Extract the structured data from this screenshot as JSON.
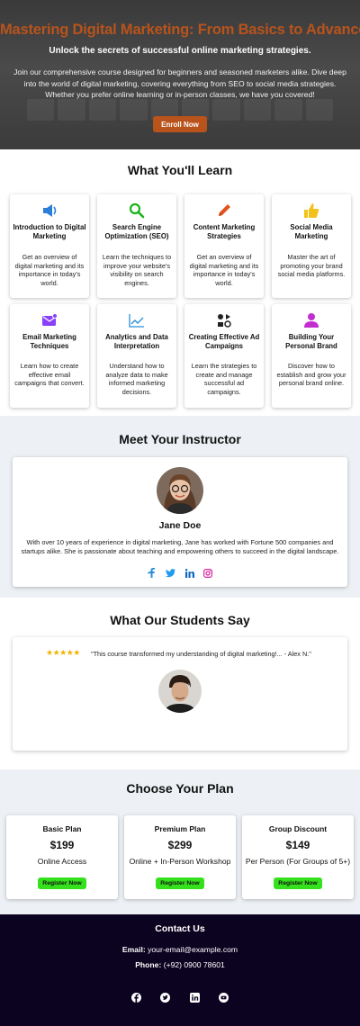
{
  "hero": {
    "title": "Mastering Digital Marketing: From Basics to Advanced",
    "subtitle": "Unlock the secrets of successful online marketing strategies.",
    "description": "Join our comprehensive course designed for beginners and seasoned marketers alike. Dive deep into the world of digital marketing, covering everything from SEO to social media strategies. Whether you prefer online learning or in-person classes, we have you covered!",
    "cta_label": "Enroll Now"
  },
  "learn": {
    "title": "What You'll Learn",
    "cards": [
      {
        "icon": "megaphone-icon",
        "title": "Introduction to Digital Marketing",
        "desc": "Get an overview of digital marketing and its importance in today's world."
      },
      {
        "icon": "search-icon",
        "title": "Search Engine Optimization (SEO)",
        "desc": "Learn the techniques to improve your website's visibility on search engines."
      },
      {
        "icon": "pencil-icon",
        "title": "Content Marketing Strategies",
        "desc": "Get an overview of digital marketing and its importance in today's world."
      },
      {
        "icon": "thumbs-up-icon",
        "title": "Social Media Marketing",
        "desc": "Master the art of promoting your brand social media platforms."
      },
      {
        "icon": "email-icon",
        "title": "Email Marketing Techniques",
        "desc": "Learn how to create effective email campaigns that convert."
      },
      {
        "icon": "chart-line-icon",
        "title": "Analytics and Data Interpretation",
        "desc": "Understand how to analyze data to make informed marketing decisions."
      },
      {
        "icon": "ads-icon",
        "title": "Creating Effective Ad Campaigns",
        "desc": "Learn the strategies to create and manage successful ad campaigns."
      },
      {
        "icon": "person-icon",
        "title": "Building Your Personal Brand",
        "desc": "Discover how to establish and grow your personal brand online."
      }
    ]
  },
  "instructor": {
    "title": "Meet Your Instructor",
    "name": "Jane Doe",
    "bio": "With over 10 years of experience in digital marketing, Jane has worked with Fortune 500 companies and startups alike. She is passionate about teaching and empowering others to succeed in the digital landscape.",
    "socials": [
      "facebook-icon",
      "twitter-icon",
      "linkedin-icon",
      "instagram-icon"
    ]
  },
  "testimonials": {
    "title": "What Our Students Say",
    "stars": "★★★★★",
    "quote": "\"This course transformed my understanding of digital marketing!... - Alex N.\""
  },
  "plans": {
    "title": "Choose Your Plan",
    "items": [
      {
        "name": "Basic Plan",
        "price": "$199",
        "desc": "Online Access",
        "button": "Register Now"
      },
      {
        "name": "Premium Plan",
        "price": "$299",
        "desc": "Online + In-Person Workshop",
        "button": "Register Now"
      },
      {
        "name": "Group Discount",
        "price": "$149",
        "desc": "Per Person (For Groups of 5+)",
        "button": "Register Now"
      }
    ]
  },
  "contact": {
    "title": "Contact Us",
    "email_label": "Email:",
    "email": "your-email@example.com",
    "phone_label": "Phone:",
    "phone": "(+92) 0900 78601",
    "socials": [
      "facebook-icon",
      "twitter-icon",
      "linkedin-icon",
      "youtube-icon"
    ]
  },
  "colors": {
    "accent": "#b8531c",
    "register_button": "#35e11c",
    "footer_bg": "#0b0320",
    "section_bg": "#edf1f5"
  }
}
